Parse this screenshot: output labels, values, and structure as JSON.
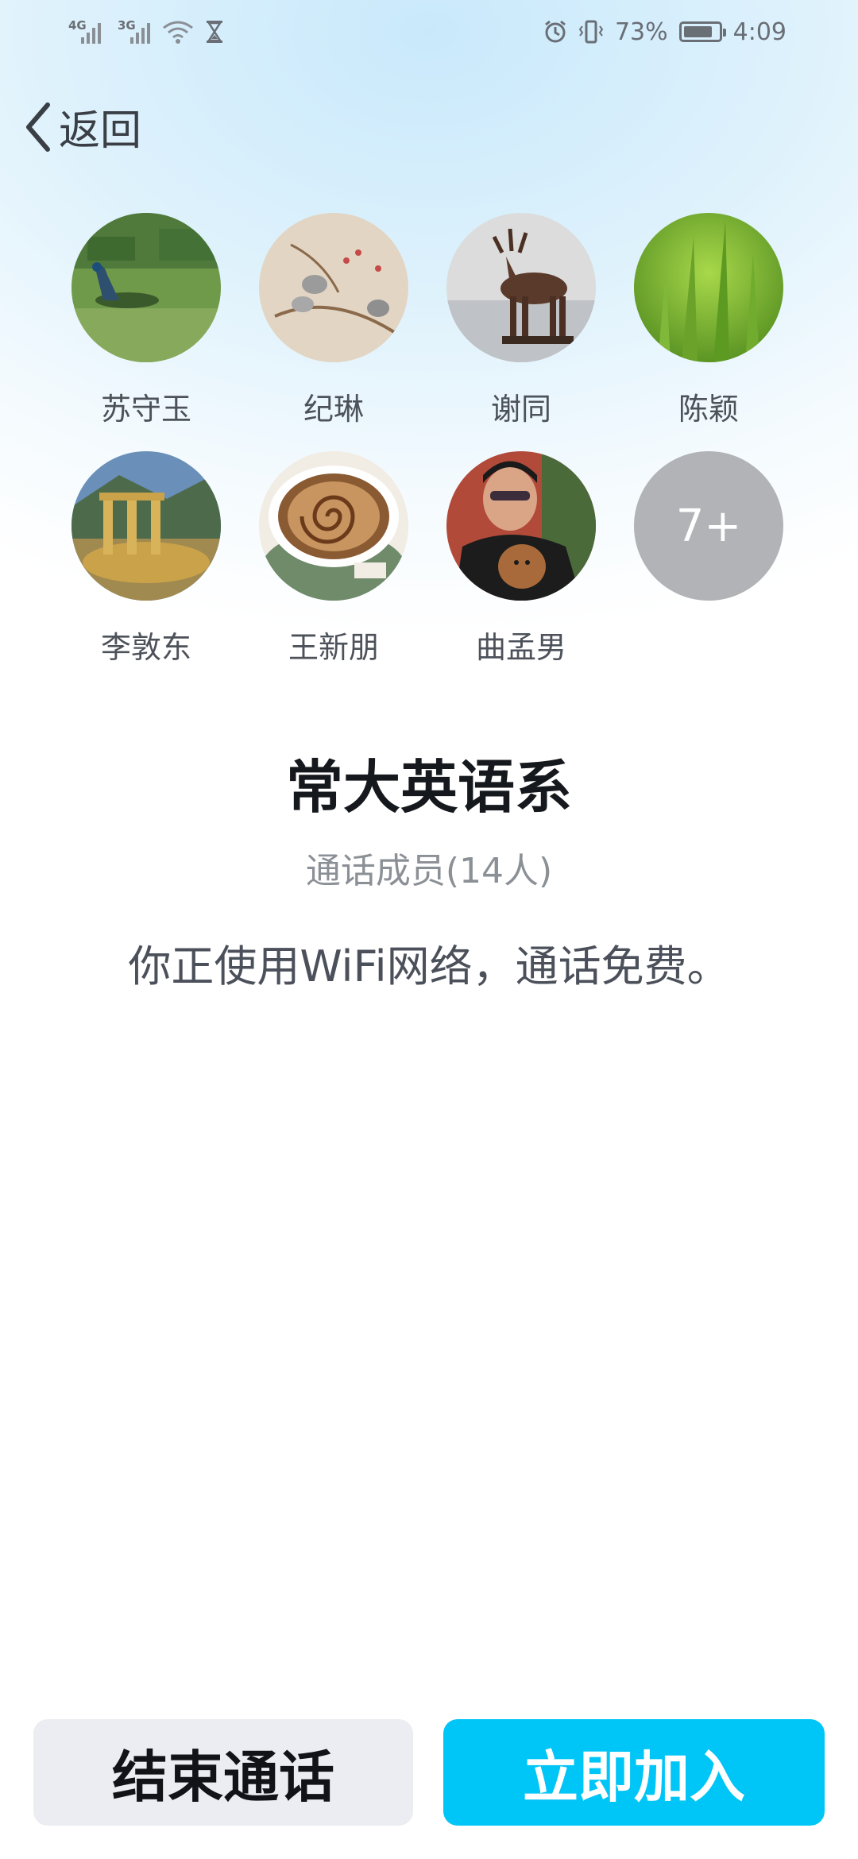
{
  "status_bar": {
    "net1": "4G",
    "net2": "3G",
    "battery_percent": "73%",
    "battery_level": 0.73,
    "time": "4:09",
    "icons": [
      "signal-icon",
      "signal-icon",
      "wifi-icon",
      "hourglass-icon",
      "alarm-icon",
      "vibrate-icon",
      "battery-icon"
    ]
  },
  "nav": {
    "back_label": "返回"
  },
  "members": [
    {
      "name": "苏守玉",
      "icon": "peacock-avatar"
    },
    {
      "name": "纪琳",
      "icon": "birds-painting-avatar"
    },
    {
      "name": "谢同",
      "icon": "deer-statue-avatar"
    },
    {
      "name": "陈颖",
      "icon": "grass-avatar"
    },
    {
      "name": "李敦东",
      "icon": "ruins-avatar"
    },
    {
      "name": "王新朋",
      "icon": "coffee-avatar"
    },
    {
      "name": "曲孟男",
      "icon": "man-with-dog-avatar"
    }
  ],
  "more_count": "7+",
  "group": {
    "title": "常大英语系",
    "members_label": "通话成员(14人)",
    "notice": "你正使用WiFi网络，通话免费。"
  },
  "actions": {
    "end_call": "结束通话",
    "join_now": "立即加入"
  },
  "colors": {
    "join_button": "#00c5f7",
    "end_button": "#ebedf2",
    "more_avatar": "#b1b3b6"
  }
}
